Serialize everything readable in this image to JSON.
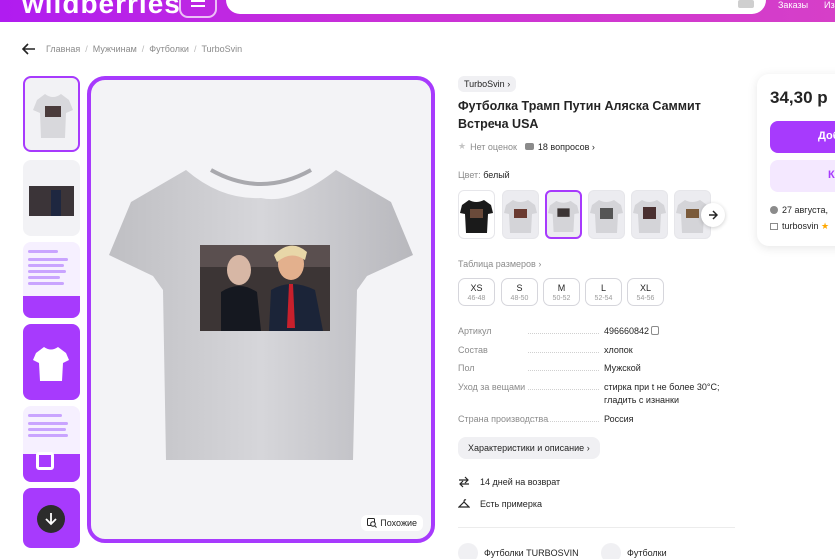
{
  "header": {
    "logo": "wildberries",
    "links": [
      "Заказы",
      "Из"
    ]
  },
  "breadcrumbs": [
    "Главная",
    "Мужчинам",
    "Футболки",
    "TurboSvin"
  ],
  "gallery": {
    "similar_label": "Похожие"
  },
  "product": {
    "brand": "TurboSvin",
    "title": "Футболка Трамп Путин Аляска Саммит Встреча USA",
    "rating_text": "Нет оценок",
    "questions_text": "18 вопросов",
    "color_label": "Цвет:",
    "color_value": "белый",
    "size_table_label": "Таблица размеров",
    "sizes": [
      {
        "size": "XS",
        "range": "46-48"
      },
      {
        "size": "S",
        "range": "48-50"
      },
      {
        "size": "M",
        "range": "50-52"
      },
      {
        "size": "L",
        "range": "52-54"
      },
      {
        "size": "XL",
        "range": "54-56"
      }
    ],
    "specs": [
      {
        "label": "Артикул",
        "value": "496660842"
      },
      {
        "label": "Состав",
        "value": "хлопок"
      },
      {
        "label": "Пол",
        "value": "Мужской"
      },
      {
        "label": "Уход за вещами",
        "value": "стирка при t не более 30°C; гладить с изнанки"
      },
      {
        "label": "Страна производства",
        "value": "Россия"
      }
    ],
    "chars_button": "Характеристики и описание",
    "features": [
      "14 дней на возврат",
      "Есть примерка"
    ],
    "categories": [
      "Футболки TURBOSVIN",
      "Футболки"
    ]
  },
  "price_card": {
    "price": "34,30 р",
    "primary_button": "Доб",
    "secondary_button": "К",
    "delivery": "27 августа,",
    "seller": "turbosvin"
  },
  "colors": {
    "accent": "#a73afd",
    "header_from": "#b01cf0",
    "header_to": "#d63fc8"
  }
}
